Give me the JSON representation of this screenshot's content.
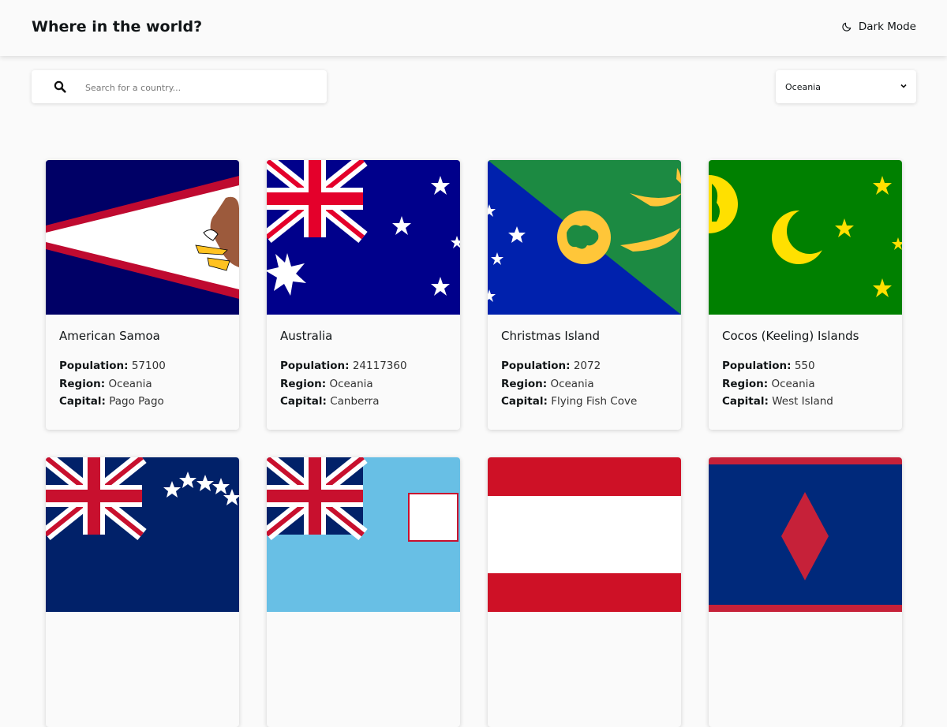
{
  "header": {
    "title": "Where in the world?",
    "dark_mode_label": "Dark Mode",
    "dark_mode_icon": "moon-outline-icon"
  },
  "search": {
    "placeholder": "Search for a country...",
    "value": "",
    "icon": "search-icon"
  },
  "filter": {
    "selected": "Oceania",
    "icon": "chevron-down-icon"
  },
  "labels": {
    "population": "Population:",
    "region": "Region:",
    "capital": "Capital:"
  },
  "countries": [
    {
      "name": "American Samoa",
      "population": "57100",
      "region": "Oceania",
      "capital": "Pago Pago"
    },
    {
      "name": "Australia",
      "population": "24117360",
      "region": "Oceania",
      "capital": "Canberra"
    },
    {
      "name": "Christmas Island",
      "population": "2072",
      "region": "Oceania",
      "capital": "Flying Fish Cove"
    },
    {
      "name": "Cocos (Keeling) Islands",
      "population": "550",
      "region": "Oceania",
      "capital": "West Island"
    }
  ],
  "colors": {
    "background": "#fafafa",
    "text": "#111517",
    "card": "#fafafa"
  }
}
